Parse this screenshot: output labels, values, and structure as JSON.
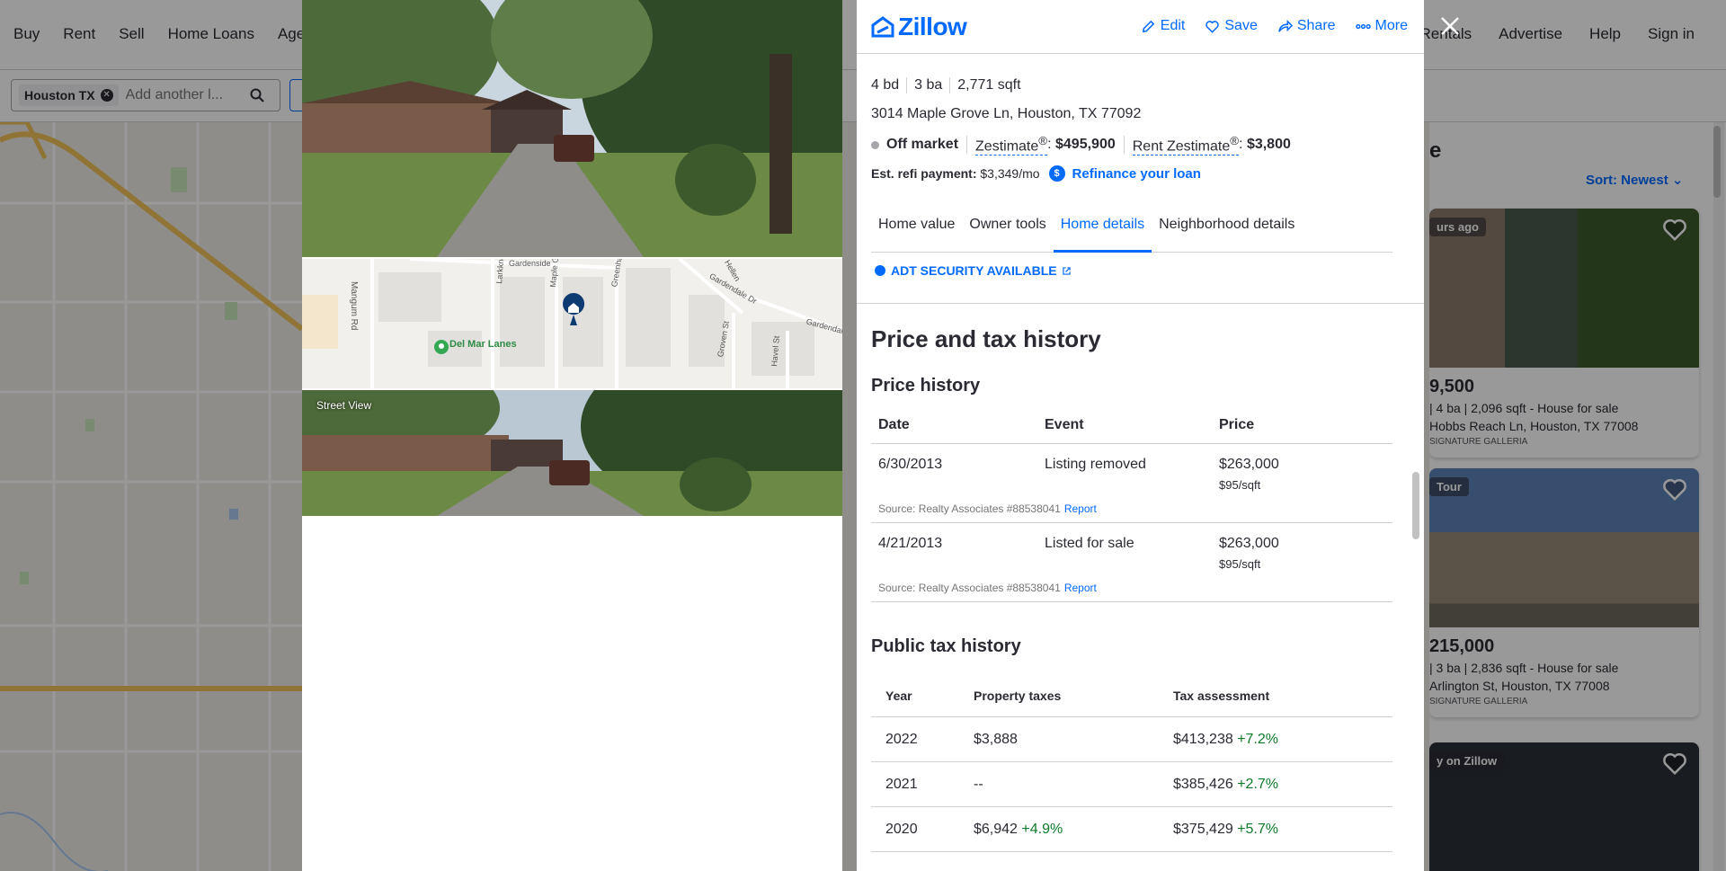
{
  "background": {
    "nav_left": [
      "Buy",
      "Rent",
      "Sell",
      "Home Loans",
      "Age"
    ],
    "nav_right": [
      "Rentals",
      "Advertise",
      "Help",
      "Sign in"
    ],
    "search": {
      "chip": "Houston TX",
      "placeholder": "Add another l..."
    },
    "list": {
      "heading": "e",
      "sort_label": "Sort: Newest",
      "cards": [
        {
          "badge": "urs ago",
          "price": "9,500",
          "facts": "| 4 ba | 2,096 sqft - House for sale",
          "address": "Hobbs Reach Ln, Houston, TX 77008",
          "broker": "SIGNATURE GALLERIA"
        },
        {
          "badge": "Tour",
          "price": "215,000",
          "facts": "| 3 ba | 2,836 sqft - House for sale",
          "address": "Arlington St, Houston, TX 77008",
          "broker": "SIGNATURE GALLERIA"
        },
        {
          "badge": "y on Zillow",
          "price": "",
          "facts": "",
          "address": "",
          "broker": ""
        }
      ]
    }
  },
  "photos": {
    "street_view_label": "Street View",
    "map_labels": {
      "poi": "Del Mar Lanes",
      "streets": [
        "Mangum Rd",
        "Larkknolls Ln",
        "Maple Grove Ln",
        "Greenhaven Ln",
        "Gardendale Dr",
        "Gardendale Dr",
        "Groven St",
        "Havel St",
        "Hellen",
        "Gardenside"
      ]
    }
  },
  "header": {
    "logo": "Zillow",
    "actions": [
      {
        "label": "Edit",
        "icon": "pencil-icon"
      },
      {
        "label": "Save",
        "icon": "heart-icon"
      },
      {
        "label": "Share",
        "icon": "share-icon"
      },
      {
        "label": "More",
        "icon": "more-dots-icon"
      }
    ]
  },
  "property": {
    "beds": "4 bd",
    "baths": "3 ba",
    "sqft": "2,771 sqft",
    "address": "3014 Maple Grove Ln, Houston, TX 77092",
    "status": "Off market",
    "zestimate_label": "Zestimate",
    "zestimate_value": "$495,900",
    "rent_zestimate_label": "Rent Zestimate",
    "rent_zestimate_value": "$3,800",
    "registered_mark": "®",
    "refi_label": "Est. refi payment:",
    "refi_value": "$3,349/mo",
    "refi_icon_text": "$",
    "refi_link": "Refinance your loan"
  },
  "tabs": [
    {
      "label": "Home value",
      "active": false
    },
    {
      "label": "Owner tools",
      "active": false
    },
    {
      "label": "Home details",
      "active": true
    },
    {
      "label": "Neighborhood details",
      "active": false
    }
  ],
  "adt": {
    "label": "ADT SECURITY AVAILABLE"
  },
  "price_tax": {
    "section_title": "Price and tax history",
    "price_history_title": "Price history",
    "price_headers": [
      "Date",
      "Event",
      "Price"
    ],
    "price_rows": [
      {
        "date": "6/30/2013",
        "event": "Listing removed",
        "price": "$263,000",
        "sqft": "$95/sqft",
        "source": "Source: Realty Associates #88538041",
        "report": "Report"
      },
      {
        "date": "4/21/2013",
        "event": "Listed for sale",
        "price": "$263,000",
        "sqft": "$95/sqft",
        "source": "Source: Realty Associates #88538041",
        "report": "Report"
      }
    ],
    "tax_title": "Public tax history",
    "tax_headers": [
      "Year",
      "Property taxes",
      "Tax assessment"
    ],
    "tax_rows": [
      {
        "year": "2022",
        "taxes": "$3,888",
        "taxes_change": "",
        "assessment": "$413,238",
        "assessment_change": "+7.2%"
      },
      {
        "year": "2021",
        "taxes": "--",
        "taxes_change": "",
        "assessment": "$385,426",
        "assessment_change": "+2.7%"
      },
      {
        "year": "2020",
        "taxes": "$6,942",
        "taxes_change": "+4.9%",
        "assessment": "$375,429",
        "assessment_change": "+5.7%"
      }
    ]
  },
  "colors": {
    "accent": "#006aff",
    "positive": "#0d7a2a",
    "text": "#2a2a33",
    "divider": "#d1d1d5"
  }
}
